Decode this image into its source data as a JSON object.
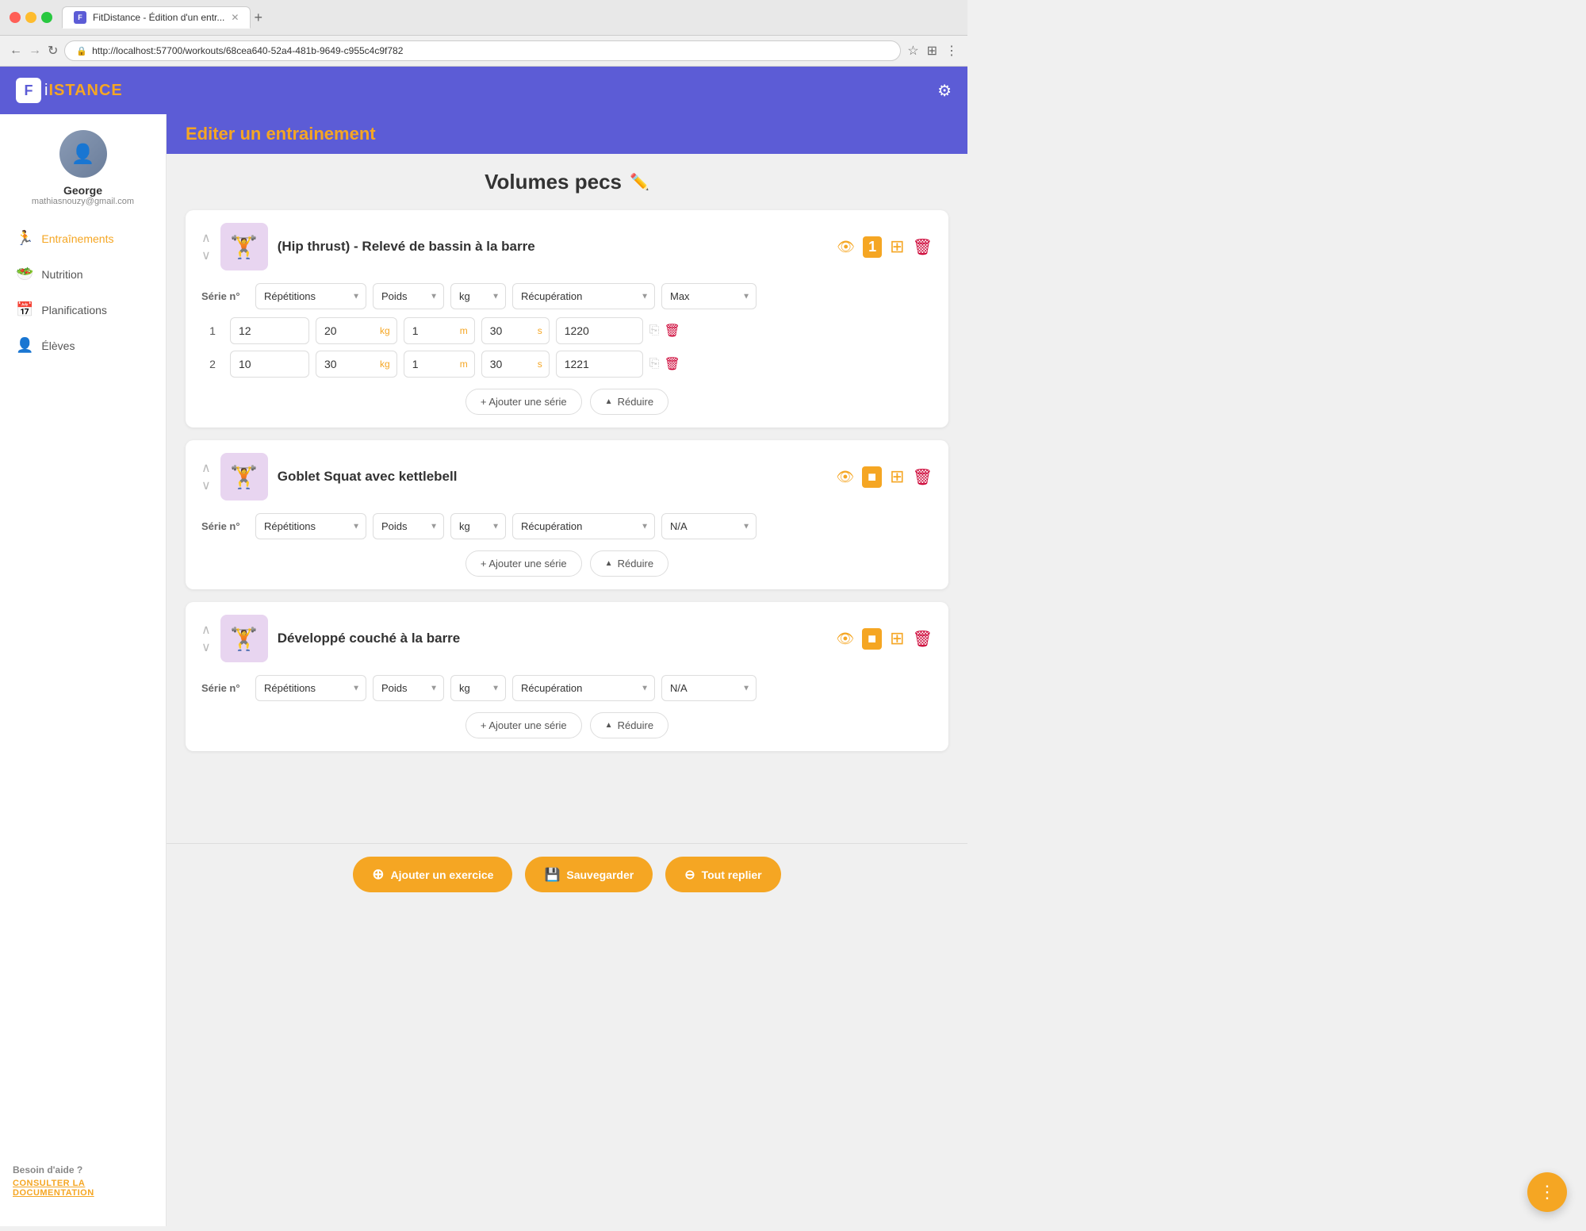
{
  "browser": {
    "url": "http://localhost:57700/workouts/68cea640-52a4-481b-9649-c955c4c9f782",
    "tab_title": "FitDistance - Édition d'un entr...",
    "tab_new": "+",
    "nav_back": "←",
    "nav_forward": "→",
    "nav_reload": "↻"
  },
  "header": {
    "logo_letter": "F",
    "logo_text_colored": "ISTANCE",
    "page_title": "Editer un entrainement",
    "settings_icon": "⚙"
  },
  "sidebar": {
    "user": {
      "name": "George",
      "email": "mathiasnouzy@gmail.com"
    },
    "nav_items": [
      {
        "id": "entrainements",
        "label": "Entraînements",
        "icon": "🏃",
        "active": true
      },
      {
        "id": "nutrition",
        "label": "Nutrition",
        "icon": "🥗",
        "active": false
      },
      {
        "id": "planifications",
        "label": "Planifications",
        "icon": "📅",
        "active": false
      },
      {
        "id": "eleves",
        "label": "Élèves",
        "icon": "👤",
        "active": false
      }
    ],
    "help_title": "Besoin d'aide ?",
    "help_link": "CONSULTER LA DOCUMENTATION"
  },
  "workout": {
    "title": "Volumes pecs",
    "edit_icon": "✏️"
  },
  "exercises": [
    {
      "id": "ex1",
      "name": "(Hip thrust) - Relevé de bassin à la barre",
      "thumb_emoji": "🏋️",
      "thumb_bg": "#e8d5f0",
      "repetitions_label": "Répétitions",
      "poids_label": "Poids",
      "kg_label": "kg",
      "recuperation_label": "Récupération",
      "max_label": "Max",
      "notification_count": "1",
      "series": [
        {
          "num": 1,
          "reps": "12",
          "poids": "20",
          "poids_unit": "kg",
          "recup1": "1",
          "recup1_unit": "m",
          "recup2": "30",
          "recup2_unit": "s",
          "max": "1220"
        },
        {
          "num": 2,
          "reps": "10",
          "poids": "30",
          "poids_unit": "kg",
          "recup1": "1",
          "recup1_unit": "m",
          "recup2": "30",
          "recup2_unit": "s",
          "max": "1221"
        }
      ],
      "add_serie_label": "+ Ajouter une série",
      "reduce_label": "^ Réduire"
    },
    {
      "id": "ex2",
      "name": "Goblet Squat avec kettlebell",
      "thumb_emoji": "🏋",
      "thumb_bg": "#e8d5f0",
      "repetitions_label": "Répétitions",
      "poids_label": "Poids",
      "kg_label": "kg",
      "recuperation_label": "Récupération",
      "max_label": "N/A",
      "notification_count": null,
      "series": [],
      "add_serie_label": "+ Ajouter une série",
      "reduce_label": "^ Réduire"
    },
    {
      "id": "ex3",
      "name": "Développé couché à la barre",
      "thumb_emoji": "🏋",
      "thumb_bg": "#e8d5f0",
      "repetitions_label": "Répétitions",
      "poids_label": "Poids",
      "kg_label": "kg",
      "recuperation_label": "Récupération",
      "max_label": "N/A",
      "notification_count": null,
      "series": [],
      "add_serie_label": "+ Ajouter une série",
      "reduce_label": "^ Réduire"
    }
  ],
  "bottom_bar": {
    "add_exercise": "Ajouter un exercice",
    "save": "Sauvegarder",
    "collapse_all": "Tout replier"
  },
  "fab": {
    "icon": "⋮"
  }
}
